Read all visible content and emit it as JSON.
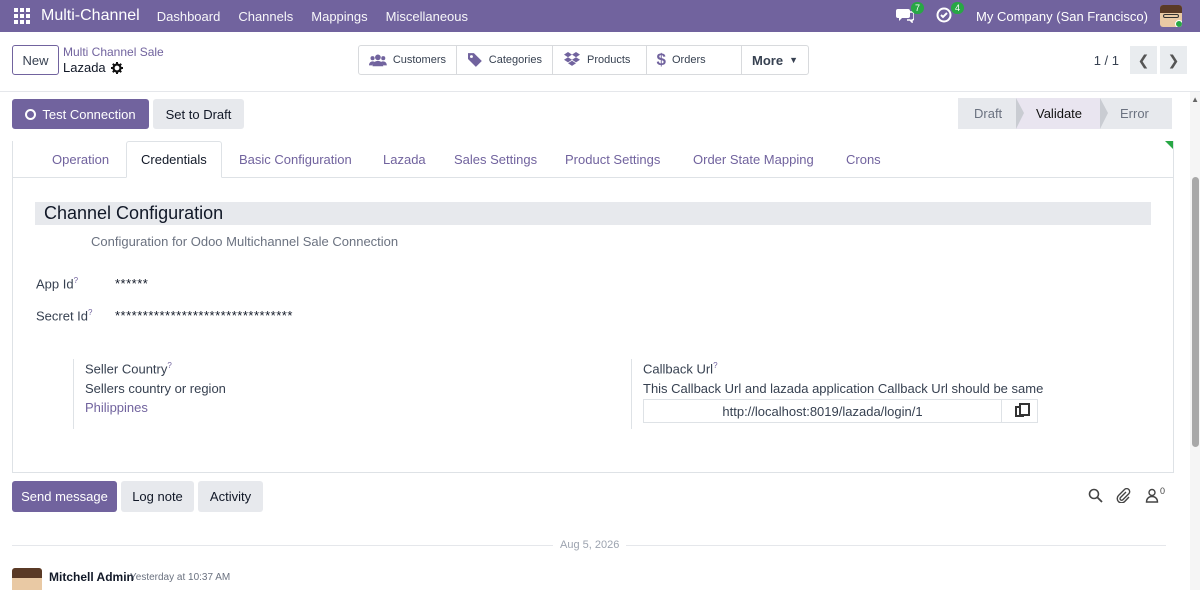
{
  "navbar": {
    "brand": "Multi-Channel",
    "menu": [
      "Dashboard",
      "Channels",
      "Mappings",
      "Miscellaneous"
    ],
    "messages_count": "7",
    "activities_count": "4",
    "company": "My Company (San Francisco)"
  },
  "control_panel": {
    "new_label": "New",
    "breadcrumb_parent": "Multi Channel Sale",
    "breadcrumb_current": "Lazada",
    "smart_buttons": [
      {
        "label": "Customers",
        "icon": "users-icon"
      },
      {
        "label": "Categories",
        "icon": "tag-icon"
      },
      {
        "label": "Products",
        "icon": "dropbox-icon"
      },
      {
        "label": "Orders",
        "icon": "dollar-icon"
      }
    ],
    "more_label": "More",
    "pager": "1 / 1"
  },
  "actions": {
    "test_connection": "Test Connection",
    "set_to_draft": "Set to Draft"
  },
  "statusbar": [
    "Draft",
    "Validate",
    "Error"
  ],
  "status_active": "Validate",
  "tabs": [
    "Operation",
    "Credentials",
    "Basic Configuration",
    "Lazada",
    "Sales Settings",
    "Product Settings",
    "Order State Mapping",
    "Crons"
  ],
  "active_tab": "Credentials",
  "section": {
    "title": "Channel Configuration",
    "subtitle": "Configuration for Odoo Multichannel Sale Connection"
  },
  "fields": {
    "app_id_label": "App Id",
    "app_id_value": "******",
    "secret_id_label": "Secret Id",
    "secret_id_value": "********************************",
    "seller_country_label": "Seller Country",
    "seller_country_help": "Sellers country or region",
    "seller_country_value": "Philippines",
    "callback_url_label": "Callback Url",
    "callback_url_help": "This Callback Url and lazada application Callback Url should be same",
    "callback_url_value": "http://localhost:8019/lazada/login/1"
  },
  "chatter": {
    "send_message": "Send message",
    "log_note": "Log note",
    "activity": "Activity",
    "followers_count": "0",
    "date_separator": "Aug 5, 2026",
    "message_author": "Mitchell Admin",
    "message_time": "Yesterday at 10:37 AM"
  },
  "colors": {
    "brand": "#71639e",
    "badge": "#28a745"
  }
}
